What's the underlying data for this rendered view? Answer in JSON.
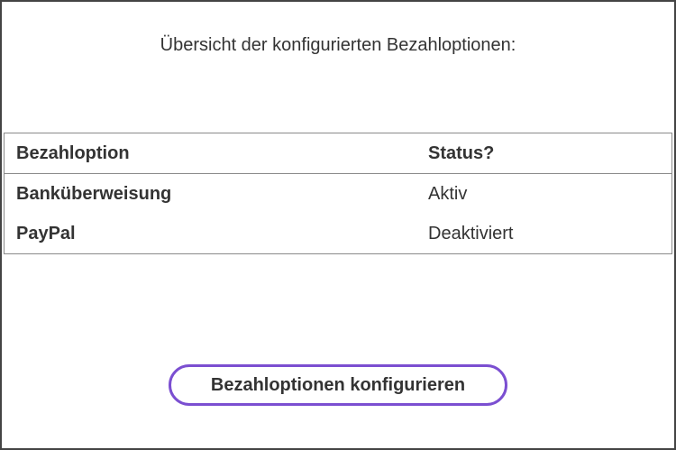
{
  "intro": {
    "text": "Übersicht der konfigurierten Bezahloptionen:"
  },
  "table": {
    "headers": {
      "option": "Bezahloption",
      "status": "Status?"
    },
    "rows": [
      {
        "option": "Banküberweisung",
        "status": "Aktiv"
      },
      {
        "option": "PayPal",
        "status": "Deaktiviert"
      }
    ]
  },
  "actions": {
    "configure_label": "Bezahloptionen konfigurieren"
  },
  "colors": {
    "accent": "#7b4fd1",
    "text": "#333333",
    "border": "#8a8a8a",
    "frame": "#444444"
  }
}
